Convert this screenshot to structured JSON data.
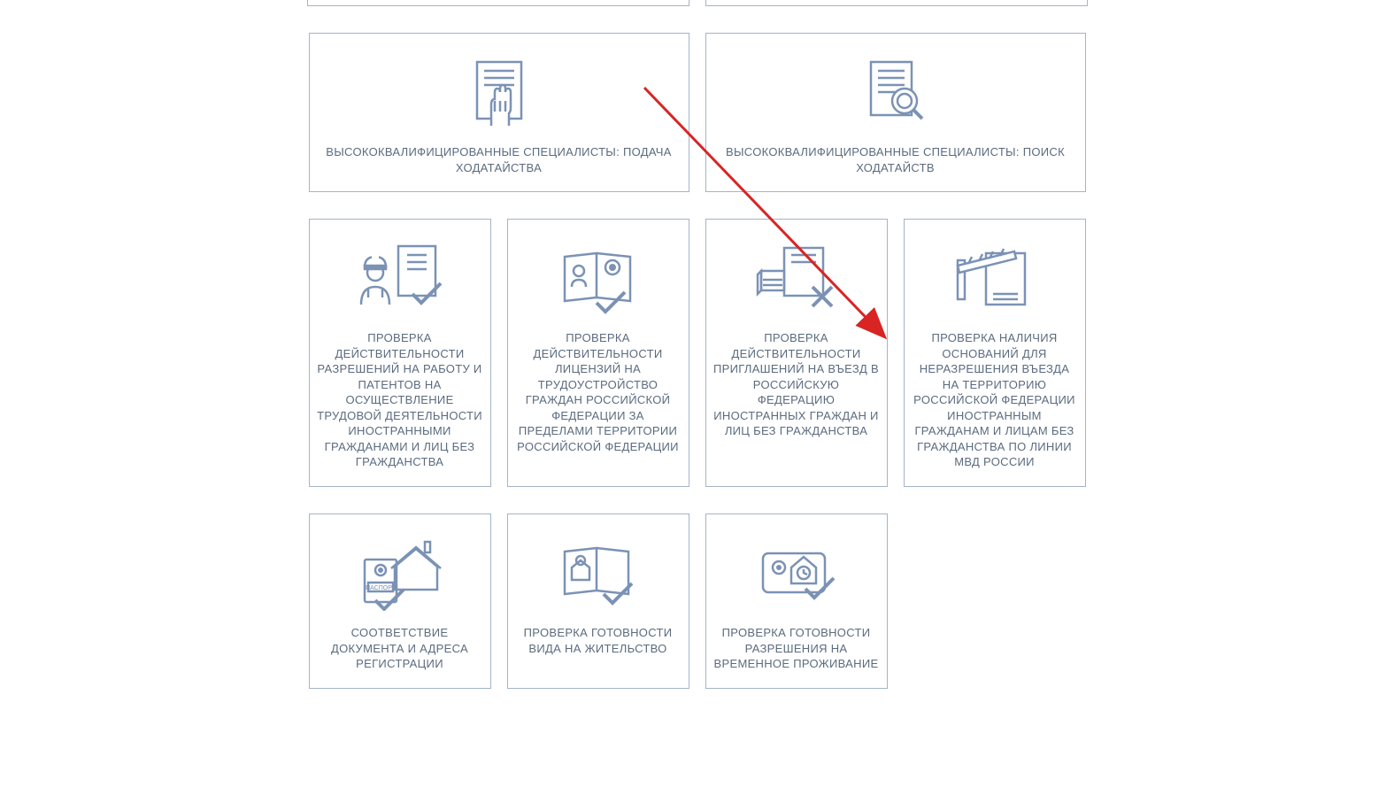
{
  "row1": {
    "card1": {
      "label": "ВЫСОКОКВАЛИФИЦИРОВАННЫЕ СПЕЦИАЛИСТЫ: ПОДАЧА ХОДАТАЙСТВА"
    },
    "card2": {
      "label": "ВЫСОКОКВАЛИФИЦИРОВАННЫЕ СПЕЦИАЛИСТЫ: ПОИСК ХОДАТАЙСТВ"
    }
  },
  "row2": {
    "card1": {
      "label": "ПРОВЕРКА ДЕЙСТВИТЕЛЬНОСТИ РАЗРЕШЕНИЙ НА РАБОТУ И ПАТЕНТОВ НА ОСУЩЕСТВЛЕНИЕ ТРУДОВОЙ ДЕЯТЕЛЬНОСТИ ИНОСТРАННЫМИ ГРАЖДАНАМИ И ЛИЦ БЕЗ ГРАЖДАНСТВА"
    },
    "card2": {
      "label": "ПРОВЕРКА ДЕЙСТВИТЕЛЬНОСТИ ЛИЦЕНЗИЙ НА ТРУДОУСТРОЙСТВО ГРАЖДАН РОССИЙСКОЙ ФЕДЕРАЦИИ ЗА ПРЕДЕЛАМИ ТЕРРИТОРИИ РОССИЙСКОЙ ФЕДЕРАЦИИ"
    },
    "card3": {
      "label": "ПРОВЕРКА ДЕЙСТВИТЕЛЬНОСТИ ПРИГЛАШЕНИЙ НА ВЪЕЗД В РОССИЙСКУЮ ФЕДЕРАЦИЮ ИНОСТРАННЫХ ГРАЖДАН И ЛИЦ БЕЗ ГРАЖДАНСТВА"
    },
    "card4": {
      "label": "ПРОВЕРКА НАЛИЧИЯ ОСНОВАНИЙ ДЛЯ НЕРАЗРЕШЕНИЯ ВЪЕЗДА НА ТЕРРИТОРИЮ РОССИЙСКОЙ ФЕДЕРАЦИИ ИНОСТРАННЫМ ГРАЖДАНАМ И ЛИЦАМ БЕЗ ГРАЖДАНСТВА ПО ЛИНИИ МВД РОССИИ"
    }
  },
  "row3": {
    "card1": {
      "label": "СООТВЕТСТВИЕ ДОКУМЕНТА И АДРЕСА РЕГИСТРАЦИИ"
    },
    "card2": {
      "label": "ПРОВЕРКА ГОТОВНОСТИ ВИДА НА ЖИТЕЛЬСТВО"
    },
    "card3": {
      "label": "ПРОВЕРКА ГОТОВНОСТИ РАЗРЕШЕНИЯ НА ВРЕМЕННОЕ ПРОЖИВАНИЕ"
    }
  }
}
